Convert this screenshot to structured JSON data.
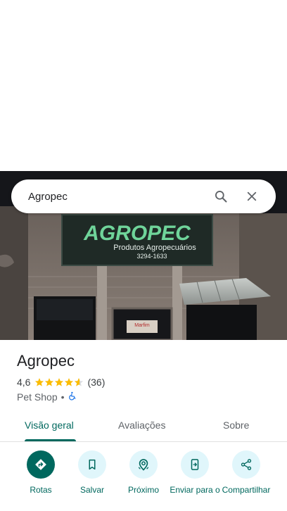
{
  "search": {
    "query": "Agropec"
  },
  "photo": {
    "sign_main": "AGROPEC",
    "sign_sub": "Produtos Agropecuários",
    "sign_phone": "3294-1633",
    "door_sign": "Marfim"
  },
  "place": {
    "name": "Agropec",
    "rating": "4,6",
    "rating_value": 4.6,
    "reviews": "(36)",
    "category": "Pet Shop",
    "separator": "•"
  },
  "tabs": [
    {
      "label": "Visão geral",
      "active": true
    },
    {
      "label": "Avaliações",
      "active": false
    },
    {
      "label": "Sobre",
      "active": false
    }
  ],
  "actions": [
    {
      "label": "Rotas",
      "icon": "directions-icon",
      "primary": true
    },
    {
      "label": "Salvar",
      "icon": "bookmark-icon",
      "primary": false
    },
    {
      "label": "Próximo",
      "icon": "nearby-icon",
      "primary": false
    },
    {
      "label": "Enviar para o",
      "icon": "send-to-phone-icon",
      "primary": false
    },
    {
      "label": "Compartilhar",
      "icon": "share-icon",
      "primary": false
    }
  ],
  "colors": {
    "accent": "#00685e",
    "action_bg": "#e0f6fb",
    "star": "#fbbc04"
  }
}
